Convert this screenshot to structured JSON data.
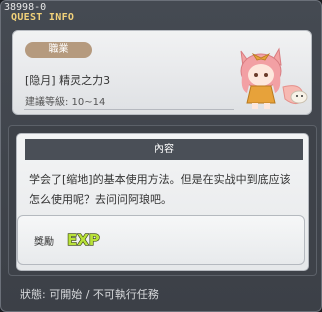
{
  "header": {
    "quest_id": "38998-0",
    "title": "QUEST INFO"
  },
  "quest": {
    "job_badge": "職業",
    "name": "[隐月] 精灵之力3",
    "level": "建議等級: 10~14"
  },
  "content": {
    "header": "內容",
    "text": "学会了[缩地]的基本使用方法。但是在实战中到底应该怎么使用呢？去问问阿琅吧。"
  },
  "reward": {
    "label": "獎勵",
    "icon": "exp-icon",
    "icon_text": "EXP"
  },
  "status": {
    "text": "狀態:  可開始  / 不可執行任務"
  },
  "colors": {
    "title": "#f2d27a",
    "badge": "#b59a7e",
    "exp": "#b9e23a"
  }
}
